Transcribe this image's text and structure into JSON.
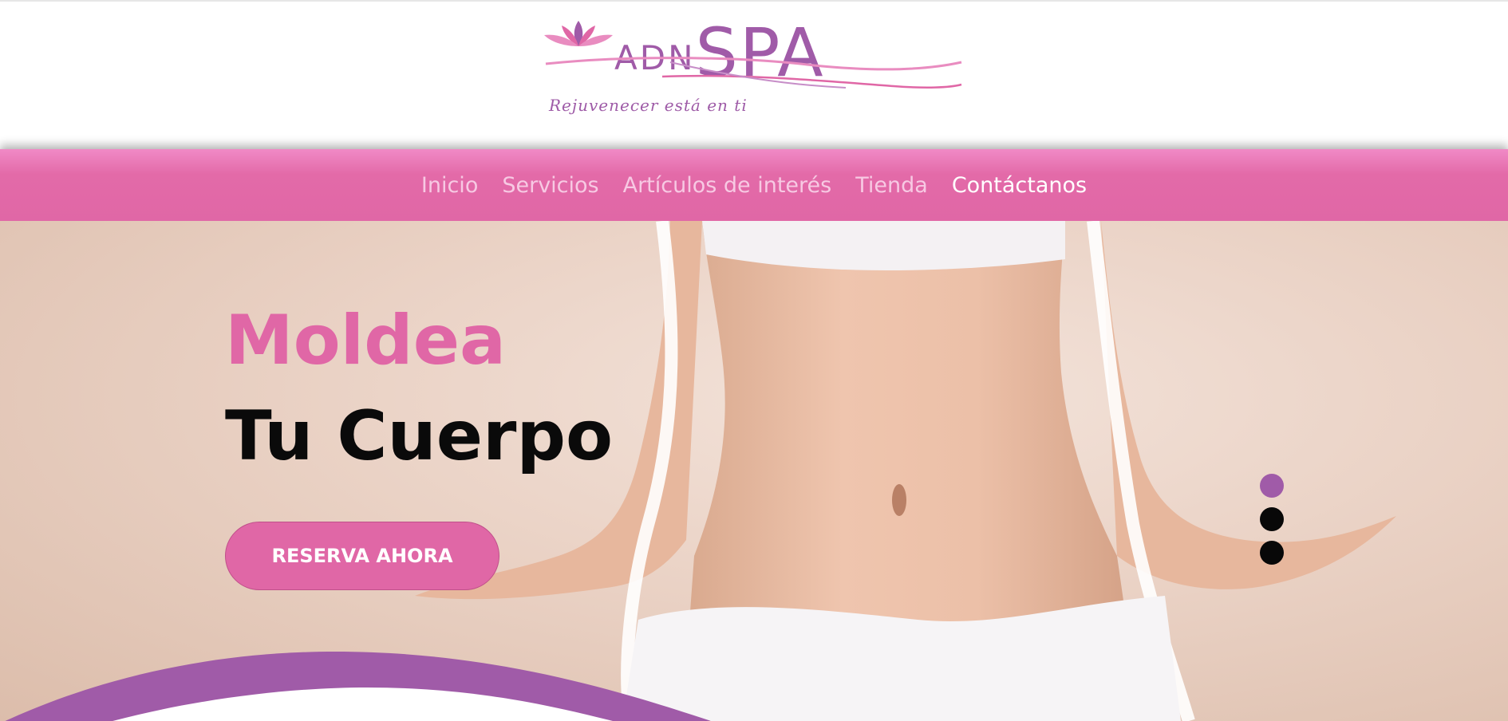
{
  "logo": {
    "brand_prefix": "ADN",
    "brand_suffix": "SPA",
    "tagline": "Rejuvenecer está en ti",
    "colors": {
      "purple": "#a05ba8",
      "pink": "#e067a6"
    }
  },
  "nav": {
    "items": [
      {
        "label": "Inicio"
      },
      {
        "label": "Servicios"
      },
      {
        "label": "Artículos de interés"
      },
      {
        "label": "Tienda"
      },
      {
        "label": "Contáctanos"
      }
    ],
    "active_index": 4
  },
  "hero": {
    "title_line1": "Moldea",
    "title_line2": "Tu Cuerpo",
    "cta_label": "RESERVA AHORA",
    "slider": {
      "slides": 3,
      "active_index": 0
    }
  },
  "colors": {
    "accent_pink": "#e067a6",
    "accent_purple": "#a05ba8",
    "nav_pink": "#e36aa8"
  },
  "icons": [
    "lotus-logo-icon"
  ]
}
